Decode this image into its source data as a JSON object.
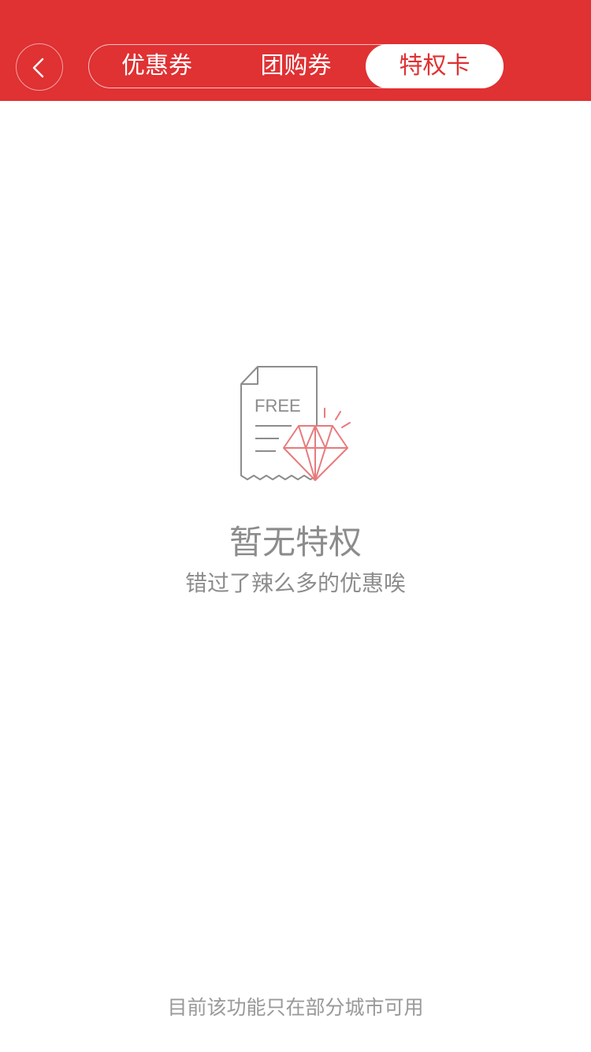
{
  "header": {
    "background_color": "#e03133",
    "back_icon": "chevron-left-icon",
    "tabs": [
      {
        "label": "优惠券",
        "active": false
      },
      {
        "label": "团购券",
        "active": false
      },
      {
        "label": "特权卡",
        "active": true
      }
    ]
  },
  "empty_state": {
    "icon": "free-coupon-diamond-icon",
    "icon_text": "FREE",
    "title": "暂无特权",
    "subtitle": "错过了辣么多的优惠唉"
  },
  "footer": {
    "note": "目前该功能只在部分城市可用"
  },
  "colors": {
    "accent": "#e03133",
    "diamond": "#e87a7c",
    "muted_text": "#8c8c8c"
  }
}
